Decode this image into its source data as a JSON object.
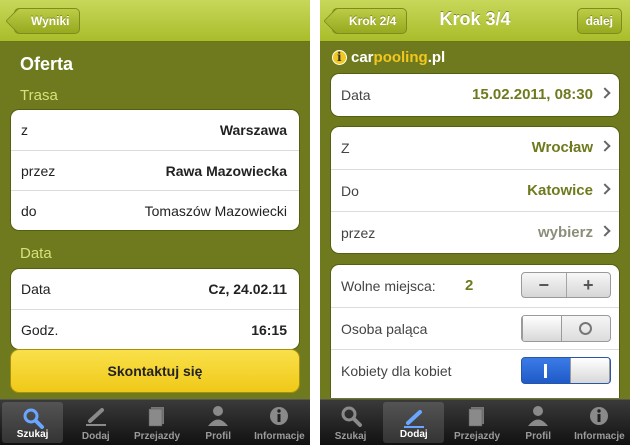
{
  "left": {
    "nav": {
      "back_label": "Wyniki"
    },
    "title": "Oferta",
    "route_section": "Trasa",
    "route": [
      {
        "label": "z",
        "value": "Warszawa"
      },
      {
        "label": "przez",
        "value": "Rawa Mazowiecka"
      },
      {
        "label": "do",
        "value": "Tomaszów Mazowiecki"
      }
    ],
    "date_section": "Data",
    "date": [
      {
        "label": "Data",
        "value": "Cz, 24.02.11"
      },
      {
        "label": "Godz.",
        "value": "16:15"
      }
    ],
    "cta_label": "Skontaktuj się",
    "tabs": [
      "Szukaj",
      "Dodaj",
      "Przejazdy",
      "Profil",
      "Informacje"
    ],
    "active_tab": "Szukaj"
  },
  "right": {
    "nav": {
      "back_label": "Krok 2/4",
      "title": "Krok 3/4",
      "next_label": "dalej"
    },
    "logo": {
      "prefix": "car",
      "highlight": "pooling",
      "suffix": ".pl"
    },
    "date": {
      "label": "Data",
      "value": "15.02.2011, 08:30"
    },
    "route": [
      {
        "label": "Z",
        "value": "Wrocław"
      },
      {
        "label": "Do",
        "value": "Katowice"
      },
      {
        "label": "przez",
        "value": "wybierz"
      }
    ],
    "options": {
      "seats_label": "Wolne miejsca:",
      "seats_value": "2",
      "minus": "−",
      "plus": "+",
      "smoker_label": "Osoba paląca",
      "women_label": "Kobiety dla kobiet"
    },
    "tabs": [
      "Szukaj",
      "Dodaj",
      "Przejazdy",
      "Profil",
      "Informacje"
    ],
    "active_tab": "Dodaj"
  },
  "colors": {
    "olive": "#6f7a1e",
    "lime": "#b5c83a",
    "yellow": "#f3cd20",
    "toggle_on": "#2a66d6"
  }
}
